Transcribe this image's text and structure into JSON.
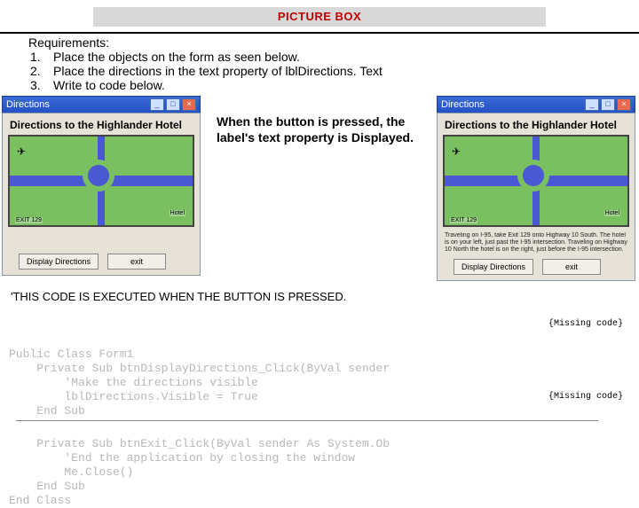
{
  "header": {
    "title": "PICTURE BOX"
  },
  "requirements": {
    "title": "Requirements:",
    "items": [
      "Place the objects on the form as seen below.",
      "Place the directions in the text property of lblDirections. Text",
      "Write to code below."
    ]
  },
  "caption": "When the button is pressed, the label's text property is Displayed.",
  "window_left": {
    "title": "Directions",
    "subtitle": "Directions to the Highlander Hotel",
    "map": {
      "exit_label": "EXIT 129",
      "hotel_label": "Hotel",
      "plane": "✈"
    },
    "buttons": {
      "display": "Display Directions",
      "exit": "exit"
    }
  },
  "window_right": {
    "title": "Directions",
    "subtitle": "Directions to the Highlander Hotel",
    "map": {
      "exit_label": "EXIT 129",
      "hotel_label": "Hotel",
      "plane": "✈"
    },
    "directions_text": "Traveling on I-95, take Exit 129 onto Highway 10 South. The hotel is on your left, just past the I-95 intersection. Traveling on Highway 10 North the hotel is on the right, just before the I-95 intersection.",
    "buttons": {
      "display": "Display Directions",
      "exit": "exit"
    }
  },
  "code": {
    "intro": "'THIS CODE IS EXECUTED WHEN THE BUTTON IS PRESSED.",
    "missing_label": "{Missing code}",
    "lines": [
      "Public Class Form1",
      "    Private Sub btnDisplayDirections_Click(ByVal sender",
      "        'Make the directions visible",
      "        lblDirections.Visible = True",
      "    End Sub",
      "",
      "    Private Sub btnExit_Click(ByVal sender As System.Ob",
      "        'End the application by closing the window",
      "        Me.Close()",
      "    End Sub",
      "End Class"
    ]
  },
  "win_controls": {
    "min": "_",
    "max": "□",
    "close": "×"
  }
}
